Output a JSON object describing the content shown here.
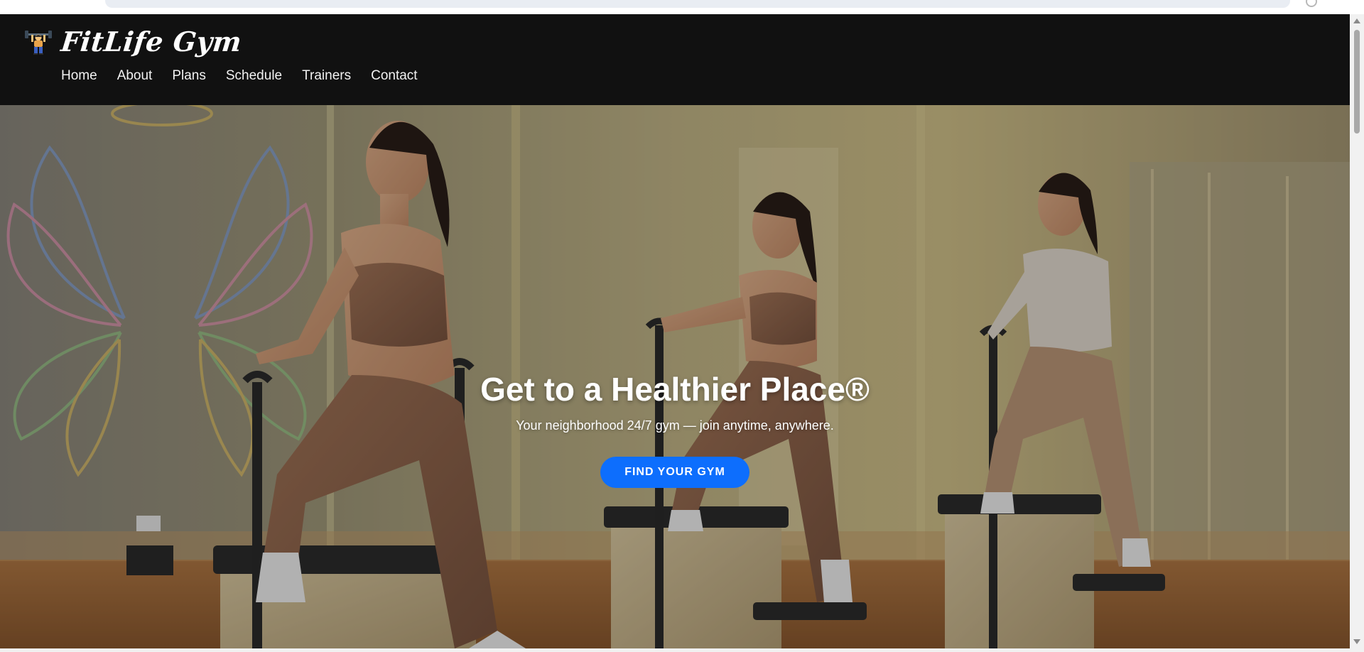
{
  "browser": {
    "omnibox_text": ""
  },
  "header": {
    "brand_name": "FitLife Gym",
    "brand_icon": "weightlifter-icon",
    "nav": [
      {
        "label": "Home"
      },
      {
        "label": "About"
      },
      {
        "label": "Plans"
      },
      {
        "label": "Schedule"
      },
      {
        "label": "Trainers"
      },
      {
        "label": "Contact"
      }
    ]
  },
  "hero": {
    "title": "Get to a Healthier Place®",
    "subtitle": "Your neighborhood 24/7 gym — join anytime, anywhere.",
    "cta_label": "FIND YOUR GYM",
    "background": "photo-pilates-studio-three-women",
    "colors": {
      "cta": "#0d6efd",
      "header_bg": "#111111",
      "wall": "#b9ab7a",
      "floor": "#a0673a"
    }
  }
}
